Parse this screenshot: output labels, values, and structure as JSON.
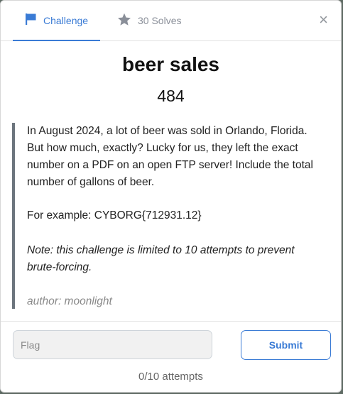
{
  "tabs": {
    "challenge_label": "Challenge",
    "solves_label": "30 Solves"
  },
  "close_symbol": "×",
  "challenge": {
    "name": "beer sales",
    "points": "484",
    "description": {
      "paragraph1": "In August 2024, a lot of beer was sold in Orlando, Florida. But how much, exactly? Lucky for us, they left the exact number on a PDF on an open FTP server! Include the total number of gallons of beer.",
      "paragraph2": "For example: CYBORG{712931.12}",
      "note": "Note: this challenge is limited to 10 attempts to prevent brute-forcing.",
      "author": "author: moonlight"
    }
  },
  "form": {
    "flag_placeholder": "Flag",
    "submit_label": "Submit",
    "attempts": "0/10 attempts"
  },
  "colors": {
    "accent": "#3a7bd5",
    "muted": "#8a8f99"
  },
  "icons": {
    "challenge_tab": "flag-icon",
    "solves_tab": "star-icon"
  }
}
